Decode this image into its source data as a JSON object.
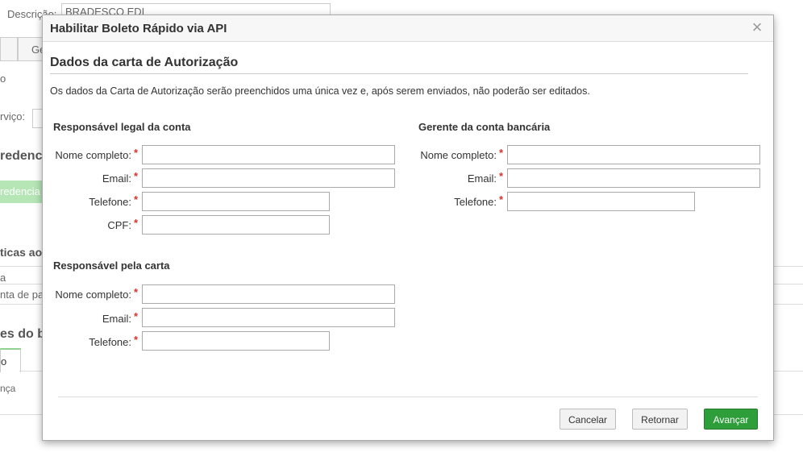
{
  "background": {
    "descricao_label": "Descrição:",
    "descricao_value": "BRADESCO EDI",
    "tab_fragment": "Ge",
    "text_o": "o",
    "servico_label": "rviço:",
    "credenc_heading": "redenc",
    "credenc_button": "redencia",
    "ticas_label": "ticas ao",
    "a_label": "a",
    "nta_label": "nta de pa",
    "es_do_bo": "es do bo",
    "tab_o": "o",
    "nca_label": "nça"
  },
  "modal": {
    "title": "Habilitar Boleto Rápido via API",
    "close_glyph": "×",
    "section_title": "Dados da carta de Autorização",
    "info_text": "Os dados da Carta de Autorização serão preenchidos uma única vez e, após serem enviados, não poderão ser editados.",
    "required_mark": "*",
    "legal": {
      "title": "Responsável legal da conta",
      "nome_label": "Nome completo:",
      "email_label": "Email:",
      "telefone_label": "Telefone:",
      "cpf_label": "CPF:"
    },
    "gerente": {
      "title": "Gerente da conta bancária",
      "nome_label": "Nome completo:",
      "email_label": "Email:",
      "telefone_label": "Telefone:"
    },
    "carta": {
      "title": "Responsável pela carta",
      "nome_label": "Nome completo:",
      "email_label": "Email:",
      "telefone_label": "Telefone:"
    },
    "buttons": {
      "cancelar": "Cancelar",
      "retornar": "Retornar",
      "avancar": "Avançar"
    }
  }
}
